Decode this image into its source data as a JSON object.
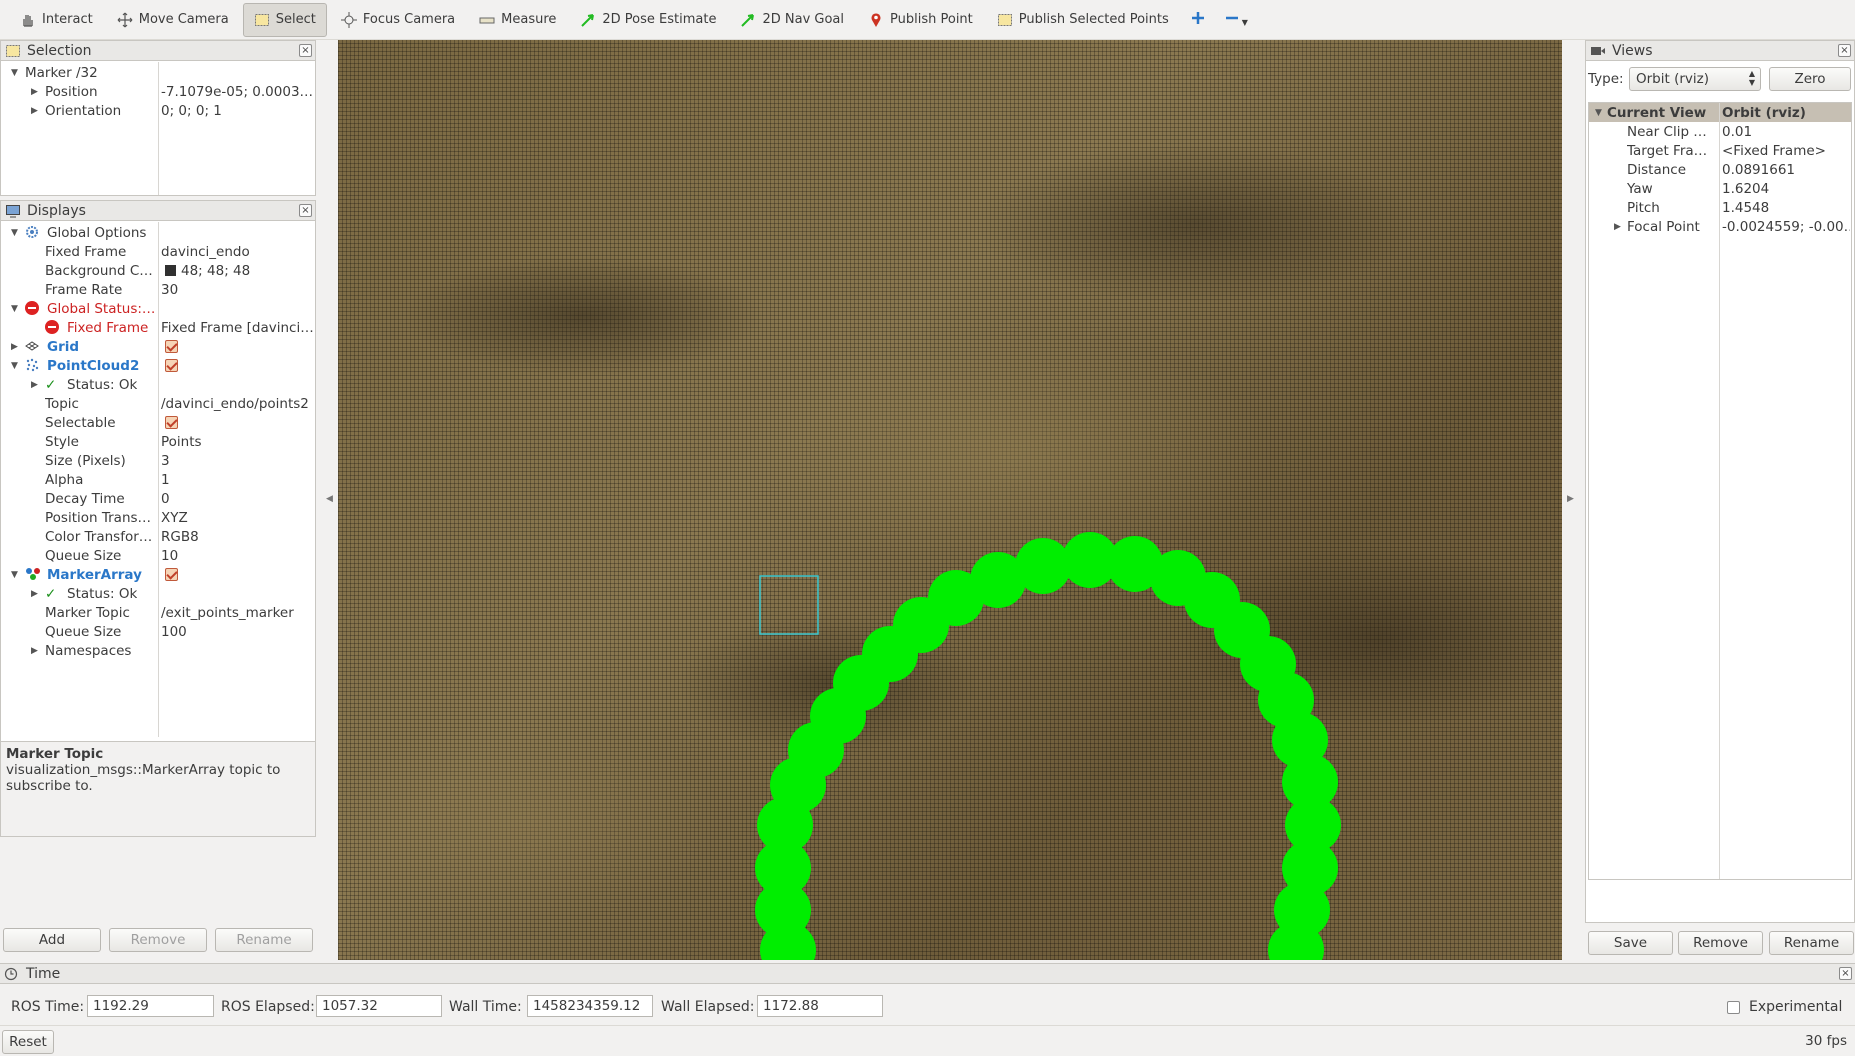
{
  "toolbar": {
    "items": [
      {
        "label": "Interact",
        "icon": "hand-icon"
      },
      {
        "label": "Move Camera",
        "icon": "move-camera-icon"
      },
      {
        "label": "Select",
        "icon": "select-icon",
        "active": true
      },
      {
        "label": "Focus Camera",
        "icon": "focus-camera-icon"
      },
      {
        "label": "Measure",
        "icon": "ruler-icon"
      },
      {
        "label": "2D Pose Estimate",
        "icon": "green-arrow-icon"
      },
      {
        "label": "2D Nav Goal",
        "icon": "green-arrow-icon"
      },
      {
        "label": "Publish Point",
        "icon": "map-pin-icon"
      },
      {
        "label": "Publish Selected Points",
        "icon": "select-icon"
      }
    ]
  },
  "selection": {
    "title": "Selection",
    "marker": "Marker /32",
    "rows": [
      {
        "key": "Position",
        "value": "-7.1079e-05; 0.0003…"
      },
      {
        "key": "Orientation",
        "value": "0; 0; 0; 1"
      }
    ]
  },
  "displays": {
    "title": "Displays",
    "global_options": "Global Options",
    "fixed_frame_key": "Fixed Frame",
    "fixed_frame_val": "davinci_endo",
    "bg_key": "Background C…",
    "bg_val": "48; 48; 48",
    "frame_rate_key": "Frame Rate",
    "frame_rate_val": "30",
    "global_status": "Global Status:…",
    "gs_fixed_frame_key": "Fixed Frame",
    "gs_fixed_frame_val": "Fixed Frame [davinci…",
    "grid": "Grid",
    "pointcloud2": "PointCloud2",
    "pc_status": "Status: Ok",
    "pc_rows": [
      {
        "key": "Topic",
        "value": "/davinci_endo/points2"
      },
      {
        "key": "Selectable",
        "value": ""
      },
      {
        "key": "Style",
        "value": "Points"
      },
      {
        "key": "Size (Pixels)",
        "value": "3"
      },
      {
        "key": "Alpha",
        "value": "1"
      },
      {
        "key": "Decay Time",
        "value": "0"
      },
      {
        "key": "Position Trans…",
        "value": "XYZ"
      },
      {
        "key": "Color Transfor…",
        "value": "RGB8"
      },
      {
        "key": "Queue Size",
        "value": "10"
      }
    ],
    "markerarray": "MarkerArray",
    "ma_status": "Status: Ok",
    "ma_topic_key": "Marker Topic",
    "ma_topic_val": "/exit_points_marker",
    "ma_queue_key": "Queue Size",
    "ma_queue_val": "100",
    "namespaces": "Namespaces",
    "help_title": "Marker Topic",
    "help_text": "visualization_msgs::MarkerArray topic to subscribe to.",
    "add": "Add",
    "remove": "Remove",
    "rename": "Rename"
  },
  "views": {
    "title": "Views",
    "type_label": "Type:",
    "type_value": "Orbit (rviz)",
    "zero": "Zero",
    "current_view": "Current View",
    "current_view_val": "Orbit (rviz)",
    "rows": [
      {
        "key": "Near Clip …",
        "value": "0.01"
      },
      {
        "key": "Target Fra…",
        "value": "<Fixed Frame>"
      },
      {
        "key": "Distance",
        "value": "0.0891661"
      },
      {
        "key": "Yaw",
        "value": "1.6204"
      },
      {
        "key": "Pitch",
        "value": "1.4548"
      },
      {
        "key": "Focal Point",
        "value": "-0.0024559; -0.00…"
      }
    ],
    "save": "Save",
    "remove": "Remove",
    "rename": "Rename"
  },
  "time": {
    "title": "Time",
    "ros_time_label": "ROS Time:",
    "ros_time": "1192.29",
    "ros_elapsed_label": "ROS Elapsed:",
    "ros_elapsed": "1057.32",
    "wall_time_label": "Wall Time:",
    "wall_time": "1458234359.12",
    "wall_elapsed_label": "Wall Elapsed:",
    "wall_elapsed": "1172.88",
    "experimental": "Experimental",
    "reset": "Reset",
    "fps": "30 fps"
  },
  "colors": {
    "marker_green": "#00ee00",
    "selection_box": "#3cc8d0",
    "error_red": "#cc2222",
    "link_blue": "#2a77c8"
  }
}
